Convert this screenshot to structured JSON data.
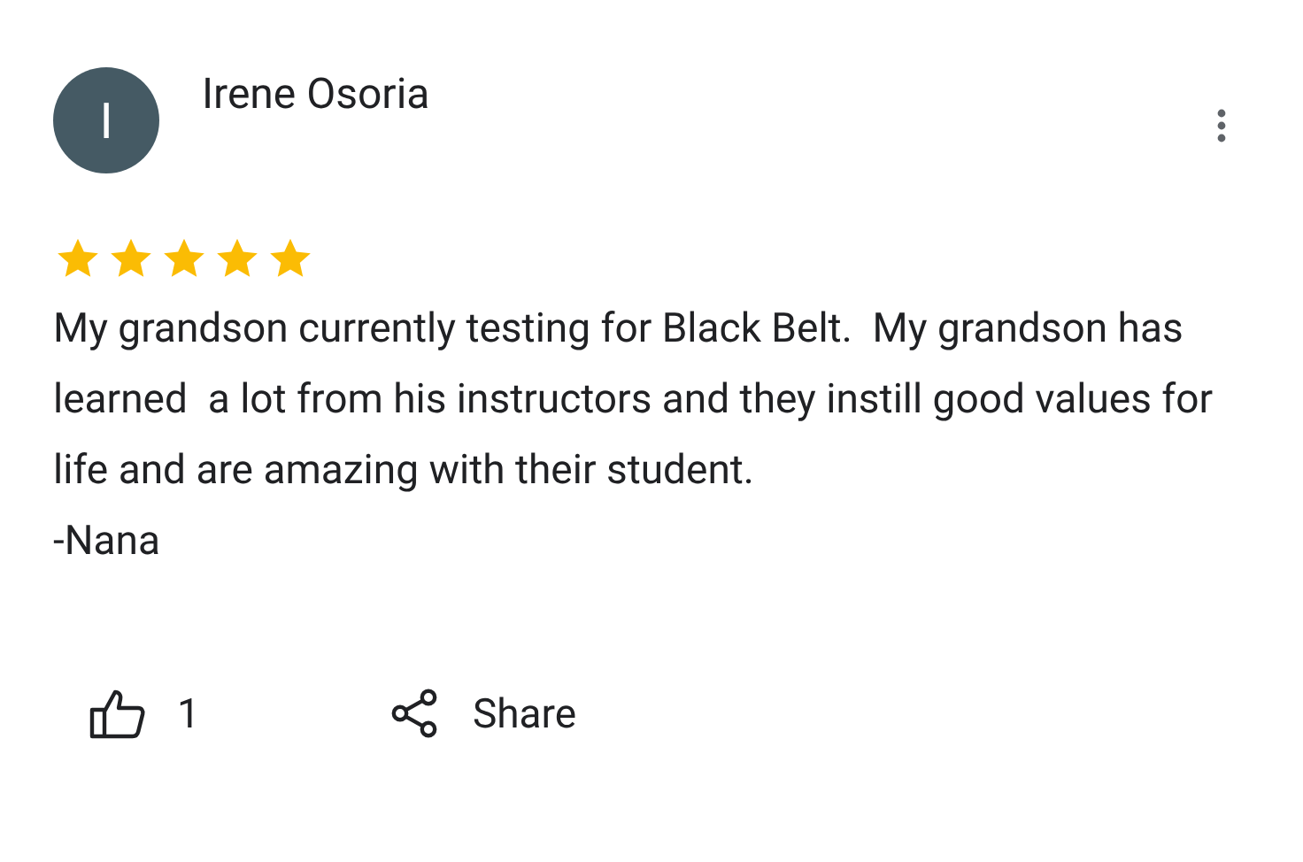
{
  "review": {
    "avatar_letter": "I",
    "author": "Irene Osoria",
    "stars": 5,
    "text": "My grandson currently testing for Black Belt.  My grandson has learned  a lot from his instructors and they instill good values for life and are amazing with their student.\n-Nana",
    "likes": "1",
    "share_label": "Share"
  }
}
